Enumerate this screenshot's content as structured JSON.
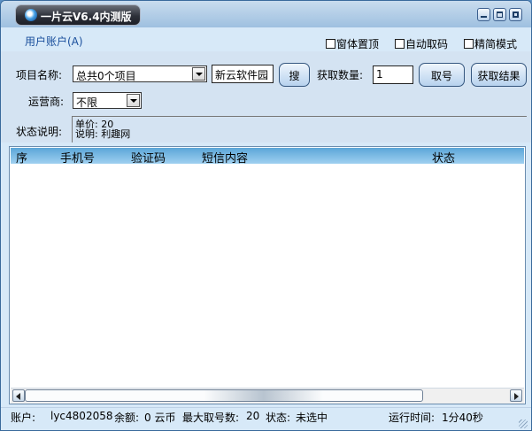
{
  "window": {
    "title": "一片云V6.4内测版",
    "minimize_icon": "minimize-icon",
    "maximize_icon": "maximize-icon",
    "close_icon": "close-icon",
    "title_bg": "#2d3039",
    "body_bg": "#d7e9f8"
  },
  "menu": {
    "user_account": "用户账户(A)"
  },
  "options": {
    "window_on_top": "窗体置顶",
    "auto_fetch": "自动取码",
    "compact_mode": "精简模式"
  },
  "form": {
    "project_label": "项目名称:",
    "project_value": "总共0个项目",
    "search_value": "新云软件园",
    "search_button": "搜",
    "count_label": "获取数量:",
    "count_value": "1",
    "fetch_button": "取号",
    "result_button": "获取结果",
    "carrier_label": "运营商:",
    "carrier_value": "不限",
    "status_label": "状态说明:",
    "status_price": "单价: 20",
    "status_desc": "说明: 利趣网"
  },
  "table": {
    "columns": [
      "序",
      "手机号",
      "验证码",
      "短信内容",
      "状态"
    ],
    "header_color": "#7bbde6",
    "rows": []
  },
  "statusbar": {
    "account_label": "账户:",
    "account_value": "lyc4802058",
    "balance_label": "余额:",
    "balance_value": "0 云币",
    "max_label": "最大取号数:",
    "max_value": "20",
    "state_label": "状态:",
    "state_value": "未选中",
    "runtime_label": "运行时间:",
    "runtime_value": "1分40秒"
  }
}
